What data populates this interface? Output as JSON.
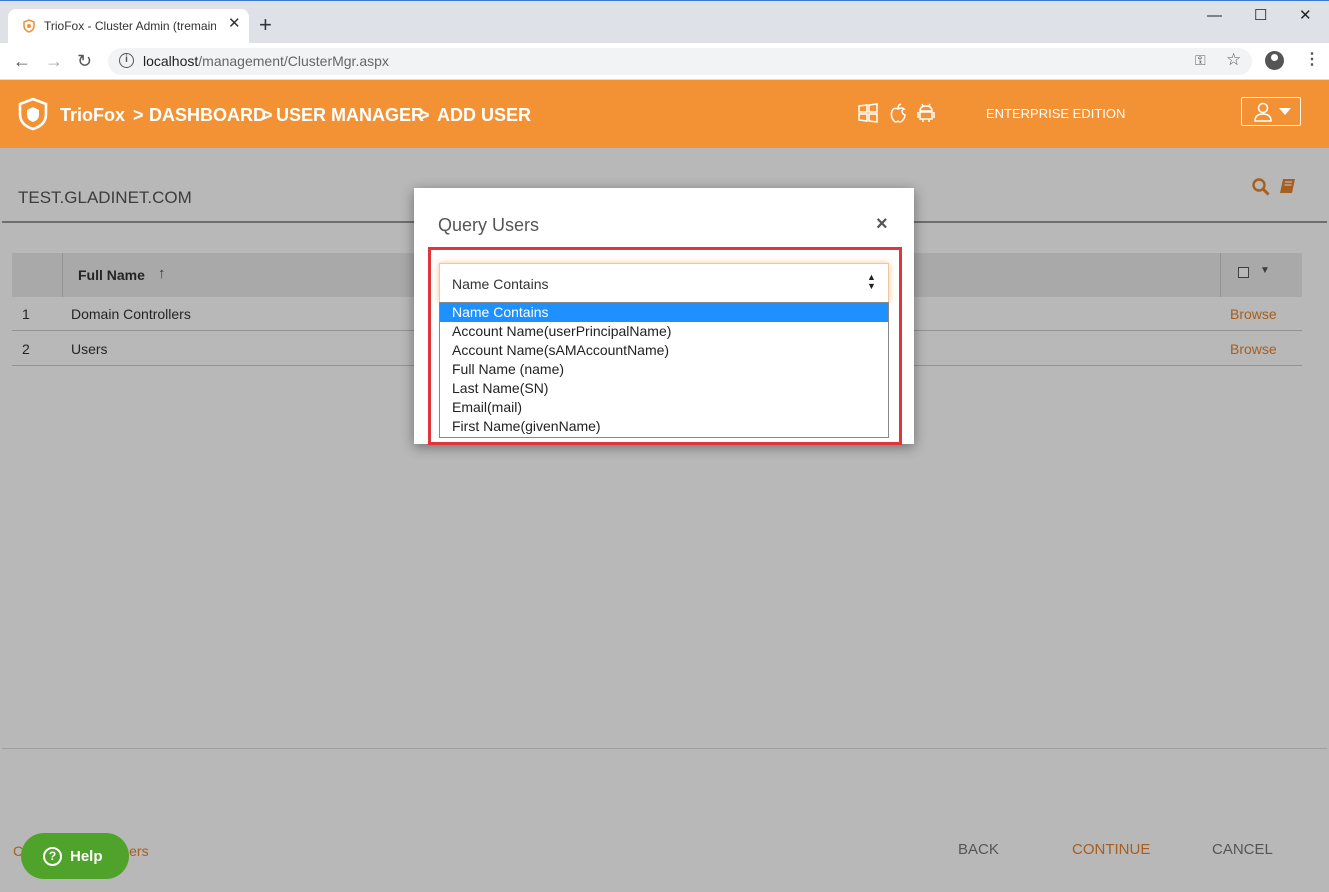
{
  "browser": {
    "tab_title": "TrioFox - Cluster Admin (tremaine",
    "tab_close": "✕",
    "new_tab": "+",
    "window_controls": {
      "minimize": "—",
      "maximize": "☐",
      "close": "✕"
    },
    "url_host": "localhost",
    "url_path": "/management/ClusterMgr.aspx",
    "icons": [
      "back-icon",
      "forward-icon",
      "reload-icon",
      "info-icon",
      "key-icon",
      "star-icon",
      "account-icon",
      "kebab-menu-icon"
    ]
  },
  "header": {
    "brand": "TrioFox",
    "breadcrumb": [
      ">",
      "DASHBOARD",
      ">",
      "USER MANAGER",
      ">",
      "ADD USER"
    ],
    "edition": "ENTERPRISE EDITION",
    "os_icons": [
      "windows-icon",
      "apple-icon",
      "android-icon"
    ],
    "accent_color": "#f39234"
  },
  "main": {
    "domain": "TEST.GLADINET.COM",
    "table": {
      "columns": [
        "Full Name"
      ],
      "sort_indicator": "↑",
      "rows": [
        {
          "num": "1",
          "name": "Domain Controllers",
          "action": "Browse"
        },
        {
          "num": "2",
          "name": "Users",
          "action": "Browse"
        }
      ]
    },
    "footer": {
      "left_link_prefix": "C",
      "left_link_suffix": "sers",
      "back": "BACK",
      "continue": "CONTINUE",
      "cancel": "CANCEL"
    },
    "help": "Help"
  },
  "modal": {
    "title": "Query Users",
    "close": "×",
    "selected": "Name Contains",
    "options": [
      "Name Contains",
      "Account Name(userPrincipalName)",
      "Account Name(sAMAccountName)",
      "Full Name (name)",
      "Last Name(SN)",
      "Email(mail)",
      "First Name(givenName)"
    ],
    "highlight_color": "#e0363b",
    "selection_color": "#1e90ff"
  }
}
